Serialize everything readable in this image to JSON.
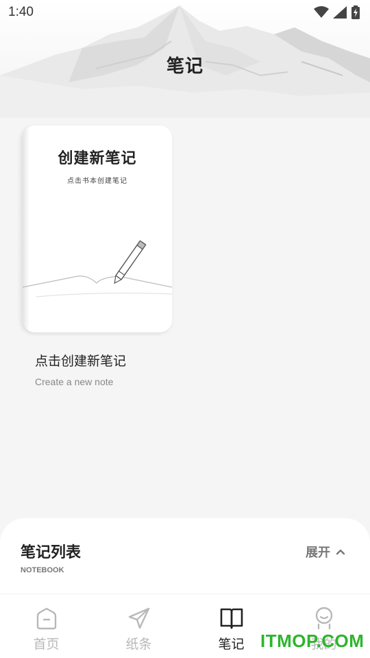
{
  "status_bar": {
    "time": "1:40",
    "icons": [
      "wifi-icon",
      "cellular-signal-icon",
      "battery-charging-icon"
    ]
  },
  "header": {
    "title": "笔记"
  },
  "create_card": {
    "title": "创建新笔记",
    "subtitle": "点击书本创建笔记",
    "label": "点击创建新笔记",
    "label_en": "Create a new note"
  },
  "notebook_sheet": {
    "title": "笔记列表",
    "subtitle": "NOTEBOOK",
    "toggle_label": "展开",
    "toggle_icon": "chevron-up-icon"
  },
  "bottom_nav": {
    "active_color": "#222222",
    "inactive_color": "#b8b8b8",
    "items": [
      {
        "label": "首页",
        "icon": "home-icon",
        "active": false
      },
      {
        "label": "纸条",
        "icon": "paper-plane-icon",
        "active": false
      },
      {
        "label": "笔记",
        "icon": "book-icon",
        "active": true
      },
      {
        "label": "我的",
        "icon": "profile-icon",
        "active": false
      }
    ]
  },
  "watermark": "ITMOP.COM"
}
